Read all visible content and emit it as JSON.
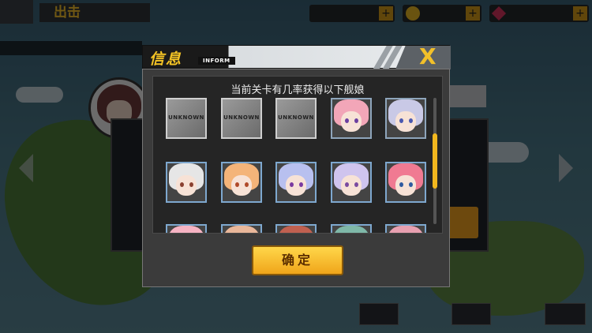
{
  "hud": {
    "title": "出击"
  },
  "dialog": {
    "title": "信息",
    "tag": "INFORM",
    "message": "当前关卡有几率获得以下舰娘",
    "close_symbol": "X",
    "confirm_label": "确定",
    "unknown_label": "UNKNOWN",
    "rewards": [
      {
        "kind": "unknown"
      },
      {
        "kind": "unknown"
      },
      {
        "kind": "unknown"
      },
      {
        "kind": "girl",
        "hair": "#f2a6b8",
        "eye": "#6b3fa0"
      },
      {
        "kind": "girl",
        "hair": "#c9c9e6",
        "eye": "#4a58b0"
      },
      {
        "kind": "girl",
        "hair": "#e6e6e6",
        "eye": "#8a4030"
      },
      {
        "kind": "girl",
        "hair": "#f4b479",
        "eye": "#b04a2a"
      },
      {
        "kind": "girl",
        "hair": "#b8c0ef",
        "eye": "#7a3aa0"
      },
      {
        "kind": "girl",
        "hair": "#cfc4ee",
        "eye": "#7a4aa0"
      },
      {
        "kind": "girl",
        "hair": "#f07a92",
        "eye": "#2f5aa0"
      },
      {
        "kind": "girl",
        "hair": "#f6b3c3",
        "eye": "#6b3fa0"
      },
      {
        "kind": "girl",
        "hair": "#e9b79a",
        "eye": "#6b3fa0"
      },
      {
        "kind": "girl",
        "hair": "#c06050",
        "eye": "#6b3fa0"
      },
      {
        "kind": "girl",
        "hair": "#7fb8a8",
        "eye": "#6b3fa0"
      },
      {
        "kind": "girl",
        "hair": "#e8a0b0",
        "eye": "#6b3fa0"
      }
    ]
  },
  "colors": {
    "accent": "#f2b71e",
    "title_yellow": "#f5c425"
  }
}
